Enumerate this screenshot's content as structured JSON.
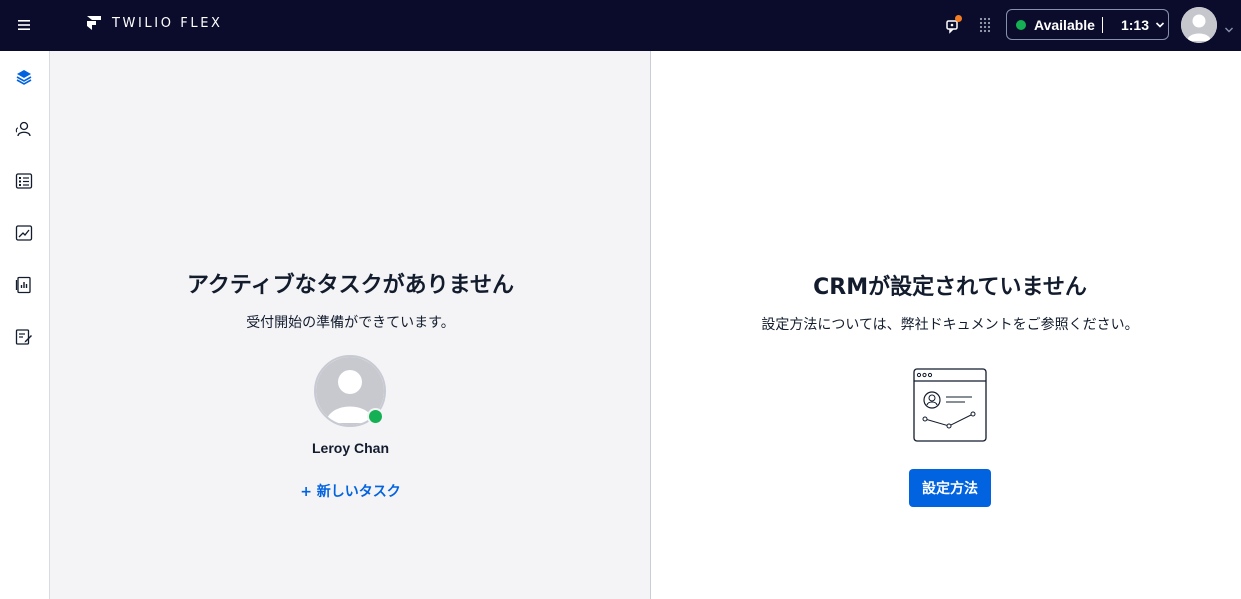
{
  "header": {
    "logo_text": "TWILIO FLEX",
    "menu_icon": "hamburger-icon",
    "notification_icon": "notification-icon",
    "notification_badge_color": "#f47c22",
    "apps_icon": "grid-dots-icon",
    "status": {
      "label": "Available",
      "time": "1:13",
      "color": "#14b053"
    },
    "avatar_icon": "user-avatar-icon"
  },
  "sidebar": {
    "items": [
      {
        "icon": "layers-icon",
        "active": true
      },
      {
        "icon": "teams-icon",
        "active": false
      },
      {
        "icon": "queues-list-icon",
        "active": false
      },
      {
        "icon": "insights-chart-icon",
        "active": false
      },
      {
        "icon": "dashboard-book-icon",
        "active": false
      },
      {
        "icon": "edit-form-icon",
        "active": false
      }
    ]
  },
  "task_panel": {
    "title": "アクティブなタスクがありません",
    "subtitle": "受付開始の準備ができています。",
    "agent_name": "Leroy Chan",
    "agent_status_color": "#14b053",
    "new_task_label": "+ 新しいタスク"
  },
  "crm_panel": {
    "title": "CRMが設定されていません",
    "subtitle": "設定方法については、弊社ドキュメントをご参照ください。",
    "illustration_icon": "crm-browser-icon",
    "setup_button_label": "設定方法"
  },
  "colors": {
    "topbar": "#0b0c2c",
    "accent": "#0263e0",
    "panel_bg": "#f4f4f6"
  }
}
